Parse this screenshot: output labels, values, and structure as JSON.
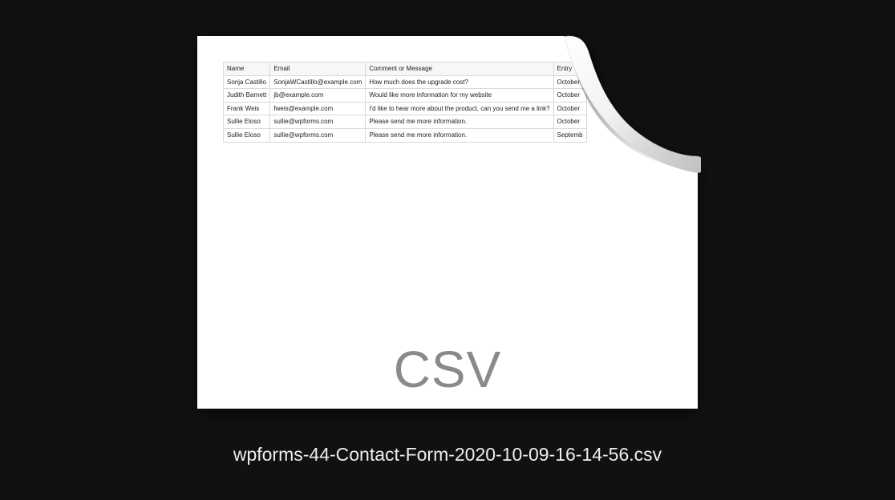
{
  "file_type_label": "CSV",
  "filename": "wpforms-44-Contact-Form-2020-10-09-16-14-56.csv",
  "table": {
    "headers": [
      "Name",
      "Email",
      "Comment or Message",
      "Entry"
    ],
    "rows": [
      {
        "name": "Sonja Castillo",
        "email": "SonjaWCastillo@example.com",
        "message": "How much does the upgrade cost?",
        "entry": "October"
      },
      {
        "name": "Judith Barnett",
        "email": "jb@example.com",
        "message": "Would like more information for my website",
        "entry": "October"
      },
      {
        "name": "Frank Weis",
        "email": "fweis@example.com",
        "message": "I'd like to hear more about the product, can you send me a link?",
        "entry": "October"
      },
      {
        "name": "Sullie Eloso",
        "email": "sullie@wpforms.com",
        "message": "Please send me more information.",
        "entry": "October"
      },
      {
        "name": "Sullie Eloso",
        "email": "sullie@wpforms.com",
        "message": "Please send me more information.",
        "entry": "Septemb"
      }
    ]
  }
}
